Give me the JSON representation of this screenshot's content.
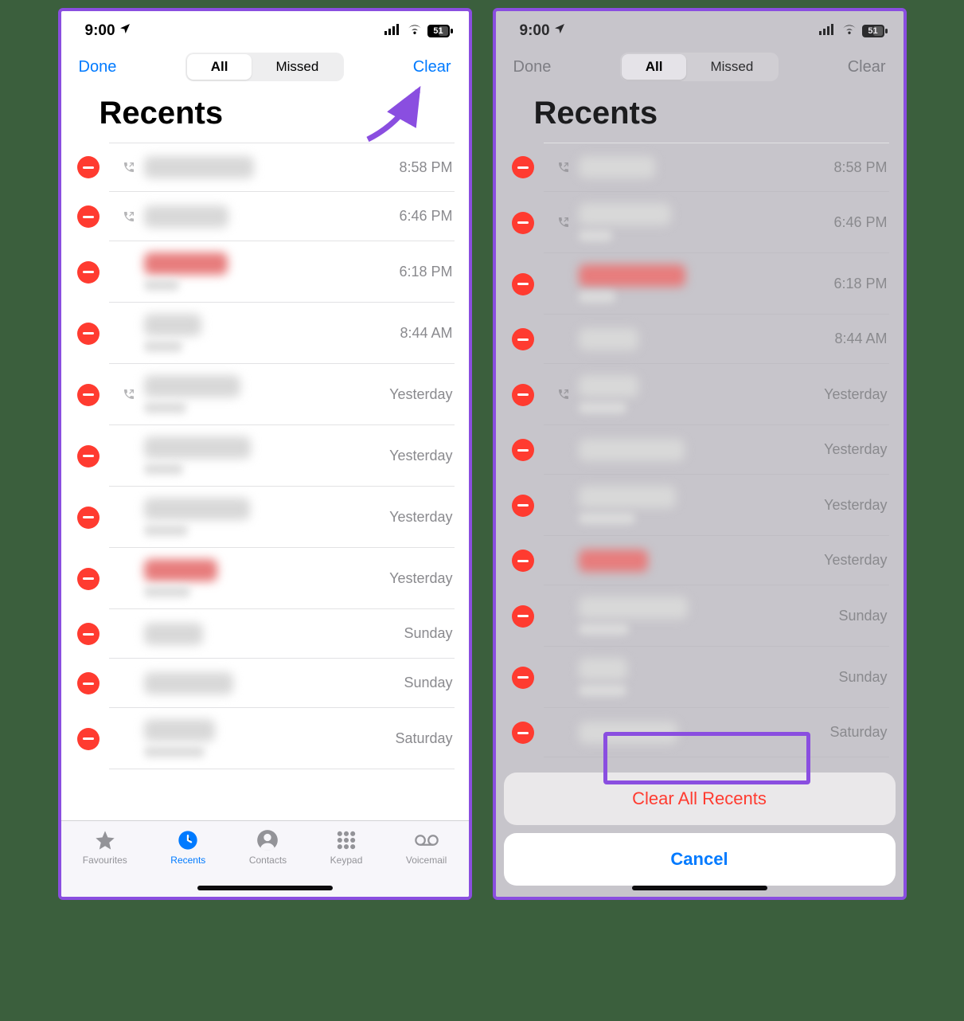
{
  "status": {
    "time": "9:00",
    "battery": "51"
  },
  "nav": {
    "done": "Done",
    "all": "All",
    "missed": "Missed",
    "clear": "Clear"
  },
  "title": "Recents",
  "calls": [
    {
      "time": "8:58 PM",
      "missed": false,
      "hasOutgoingIcon": true
    },
    {
      "time": "6:46 PM",
      "missed": false,
      "hasOutgoingIcon": true
    },
    {
      "time": "6:18 PM",
      "missed": true,
      "hasOutgoingIcon": false
    },
    {
      "time": "8:44 AM",
      "missed": false,
      "hasOutgoingIcon": false
    },
    {
      "time": "Yesterday",
      "missed": false,
      "hasOutgoingIcon": true
    },
    {
      "time": "Yesterday",
      "missed": false,
      "hasOutgoingIcon": false
    },
    {
      "time": "Yesterday",
      "missed": false,
      "hasOutgoingIcon": false
    },
    {
      "time": "Yesterday",
      "missed": true,
      "hasOutgoingIcon": false
    },
    {
      "time": "Sunday",
      "missed": false,
      "hasOutgoingIcon": false
    },
    {
      "time": "Sunday",
      "missed": false,
      "hasOutgoingIcon": false
    },
    {
      "time": "Saturday",
      "missed": false,
      "hasOutgoingIcon": false
    }
  ],
  "tabs": {
    "favourites": "Favourites",
    "recents": "Recents",
    "contacts": "Contacts",
    "keypad": "Keypad",
    "voicemail": "Voicemail"
  },
  "sheet": {
    "clearAll": "Clear All Recents",
    "cancel": "Cancel"
  }
}
